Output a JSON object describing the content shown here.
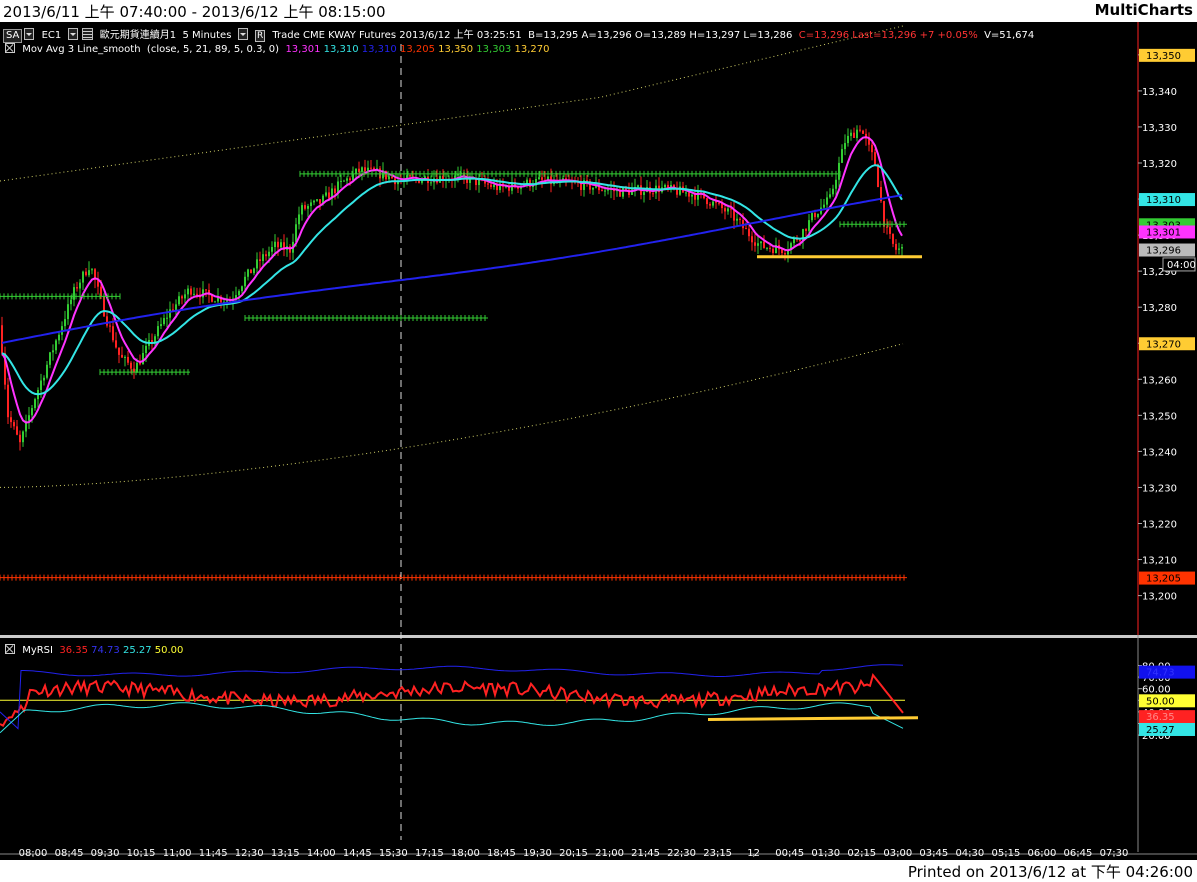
{
  "window": {
    "title": "2013/6/11 上午 07:40:00 - 2013/6/12 上午 08:15:00",
    "brand": "MultiCharts"
  },
  "header": {
    "symbol_code": "SA",
    "instrument": "EC1",
    "description": "歐元期貨連續月1",
    "interval": "5 Minutes",
    "data_feed": "R",
    "trade_info": "Trade  CME  KWAY  Futures  2013/6/12  上午  03:25:51",
    "quote": "B=13,295  A=13,296  O=13,289  H=13,297  L=13,286",
    "change": "C=13,296  Last=13,296  +7  +0.05%",
    "volume": "V=51,674"
  },
  "ma_study": {
    "name": "Mov Avg 3 Line_smooth",
    "params": "(close,  5,  21,  89,  5,  0.3,  0)",
    "values": [
      {
        "text": "13,301",
        "color": "#ff33ff"
      },
      {
        "text": "13,310",
        "color": "#33e5e5"
      },
      {
        "text": "13,310",
        "color": "#2222ee"
      },
      {
        "text": "13,205",
        "color": "#ff3300"
      },
      {
        "text": "13,350",
        "color": "#ffcc33"
      },
      {
        "text": "13,303",
        "color": "#33cc33"
      },
      {
        "text": "13,270",
        "color": "#ffcc33"
      }
    ]
  },
  "rsi_study": {
    "name": "MyRSI",
    "values": [
      {
        "text": "36.35",
        "color": "#ff2222"
      },
      {
        "text": "74.73",
        "color": "#3333ee"
      },
      {
        "text": "25.27",
        "color": "#33e5e5"
      },
      {
        "text": "50.00",
        "color": "#ffff33"
      }
    ]
  },
  "price_axis": {
    "ticks": [
      "13,350",
      "13,340",
      "13,330",
      "13,320",
      "13,310",
      "13,300",
      "13,290",
      "13,280",
      "13,270",
      "13,260",
      "13,250",
      "13,240",
      "13,230",
      "13,220",
      "13,210",
      "13,200"
    ],
    "markers": [
      {
        "value": 13350,
        "text": "13,350",
        "bg": "#ffcc33",
        "fg": "#000000"
      },
      {
        "value": 13310,
        "text": "13,310",
        "bg": "#33e5e5",
        "fg": "#000000"
      },
      {
        "value": 13303,
        "text": "13,303",
        "bg": "#33cc33",
        "fg": "#000000"
      },
      {
        "value": 13301,
        "text": "13,301",
        "bg": "#ff33ff",
        "fg": "#000000"
      },
      {
        "value": 13296,
        "text": "13,296",
        "bg": "#bbbbbb",
        "fg": "#000000"
      },
      {
        "value": 13270,
        "text": "13,270",
        "bg": "#ffcc33",
        "fg": "#000000"
      },
      {
        "value": 13205,
        "text": "13,205",
        "bg": "#ff3300",
        "fg": "#000000"
      }
    ],
    "countdown": "04:00"
  },
  "rsi_axis": {
    "ticks": [
      "80.00",
      "70.00",
      "60.00",
      "50.00",
      "40.00",
      "30.00",
      "20.00"
    ],
    "markers": [
      {
        "value": 74.73,
        "text": "74.73",
        "bg": "#1111ee",
        "fg": "#3333ff"
      },
      {
        "value": 50,
        "text": "50.00",
        "bg": "#ffff33",
        "fg": "#000000"
      },
      {
        "value": 36.35,
        "text": "36.35",
        "bg": "#ff2222",
        "fg": "#ff8888"
      },
      {
        "value": 25.27,
        "text": "25.27",
        "bg": "#33e5e5",
        "fg": "#000000"
      }
    ]
  },
  "time_axis": {
    "labels": [
      "08:00",
      "08:45",
      "09:30",
      "10:15",
      "11:00",
      "11:45",
      "12:30",
      "13:15",
      "14:00",
      "14:45",
      "15:30",
      "17:15",
      "18:00",
      "18:45",
      "19:30",
      "20:15",
      "21:00",
      "21:45",
      "22:30",
      "23:15",
      "12",
      "00:45",
      "01:30",
      "02:15",
      "03:00",
      "03:45",
      "04:30",
      "05:15",
      "06:00",
      "06:45",
      "07:30"
    ]
  },
  "footer": {
    "printed": "Printed on 2013/6/12 at 下午 04:26:00"
  },
  "colors": {
    "background": "#000000",
    "bull": "#33cc33",
    "bear": "#ff2222",
    "ma_fast": "#ff33ff",
    "ma_mid": "#33e5e5",
    "ma_slow": "#2222ee",
    "support": "#ffcc33",
    "band": "#cccc66",
    "rsi": "#ff2222"
  }
}
